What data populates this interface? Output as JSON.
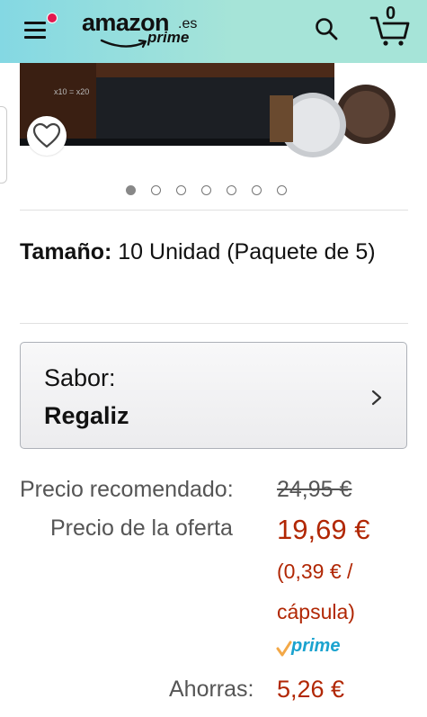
{
  "header": {
    "logo_text": "amazon",
    "logo_suffix": ".es",
    "logo_prime": "prime",
    "cart_count": "0"
  },
  "carousel": {
    "dots_total": 7,
    "active_index": 0,
    "package_text": "x10 = x20"
  },
  "size": {
    "label": "Tamaño:",
    "value": "10 Unidad (Paquete de 5)"
  },
  "flavor": {
    "label": "Sabor:",
    "value": "Regaliz"
  },
  "prices": {
    "recommended_label": "Precio recomendado:",
    "recommended_value": "24,95 €",
    "offer_label": "Precio de la oferta",
    "offer_value": "19,69 €",
    "unit_price_line1": "(0,39 € /",
    "unit_price_line2": "cápsula)",
    "prime_label": "prime",
    "savings_label": "Ahorras:",
    "savings_value": "5,26 €"
  },
  "colors": {
    "header_start": "#84d8e3",
    "header_end": "#a6e4d8",
    "price_red": "#b12704",
    "prime_blue": "#1ba3cf",
    "prime_check": "#f3a847"
  }
}
